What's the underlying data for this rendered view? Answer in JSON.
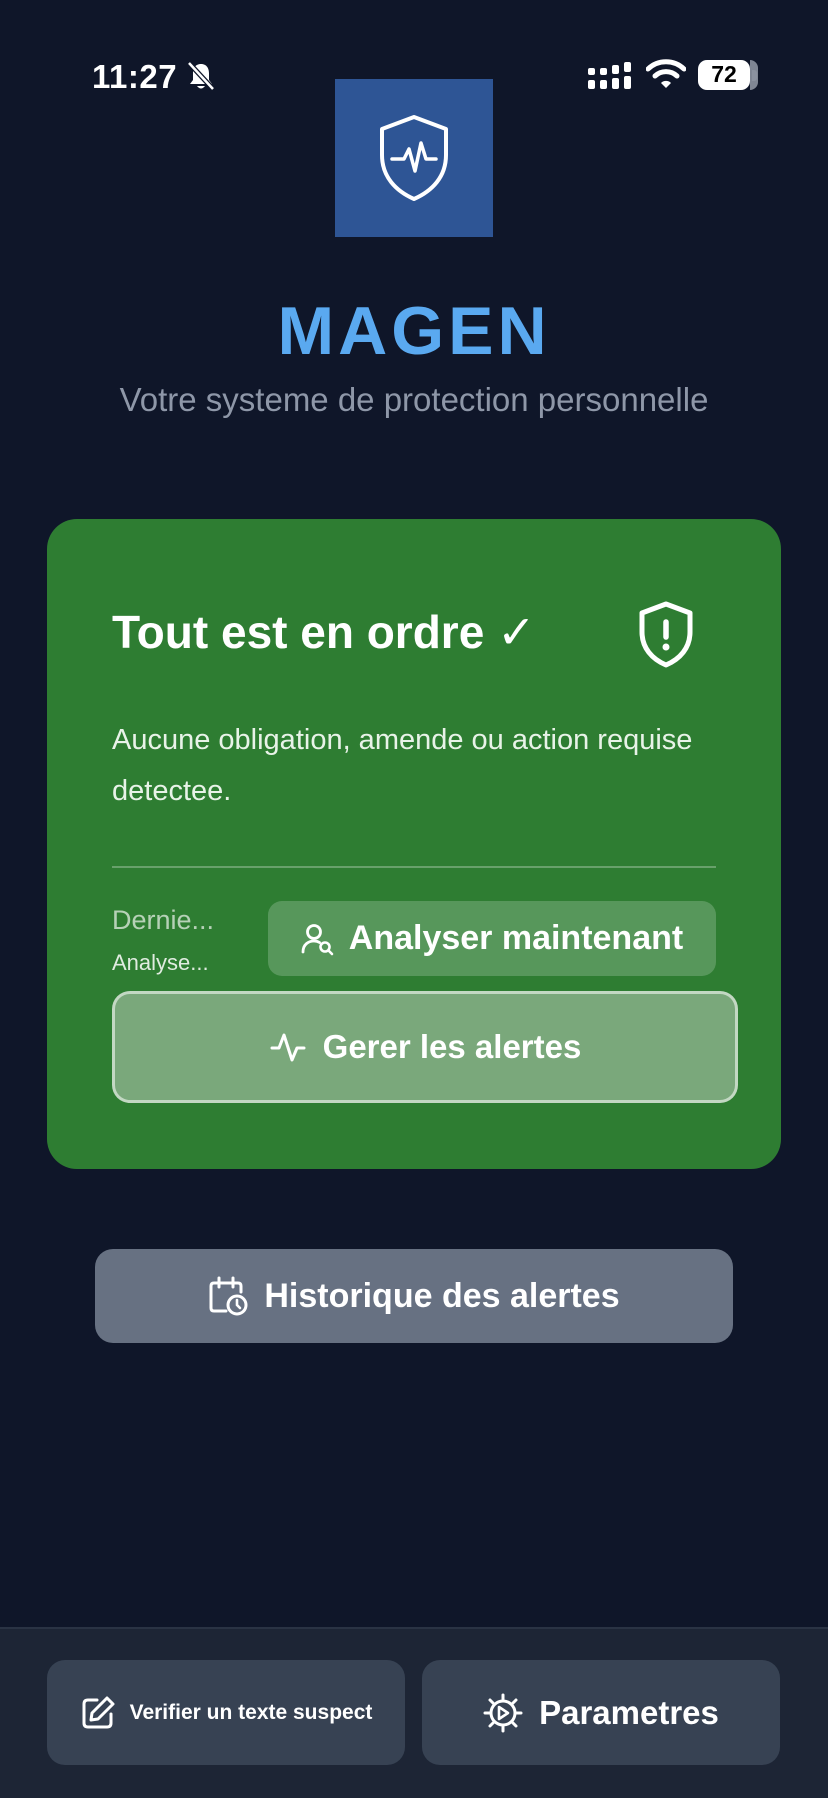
{
  "status_bar": {
    "time": "11:27",
    "battery": "72",
    "icons": [
      "bell-off-icon",
      "signal-icon",
      "wifi-icon",
      "battery-icon"
    ]
  },
  "app": {
    "logo_icon": "shield-heartbeat-icon",
    "title": "MAGEN",
    "subtitle": "Votre systeme de protection personnelle"
  },
  "status_card": {
    "title": "Tout est en ordre ✓",
    "icon": "shield-alert-icon",
    "description": "Aucune obligation, amende ou action requise detectee.",
    "last_scan_label": "Dernie...",
    "last_scan_value": "Analyse...",
    "analyze_button": "Analyser maintenant",
    "manage_alerts_button": "Gerer les alertes",
    "color": "#2e7d32"
  },
  "history_button": "Historique des alertes",
  "bottom_bar": {
    "verify_button": "Verifier un texte suspect",
    "settings_button": "Parametres"
  },
  "colors": {
    "background": "#0f1629",
    "accent": "#5aa9f0",
    "logo_bg": "#2e5595"
  }
}
